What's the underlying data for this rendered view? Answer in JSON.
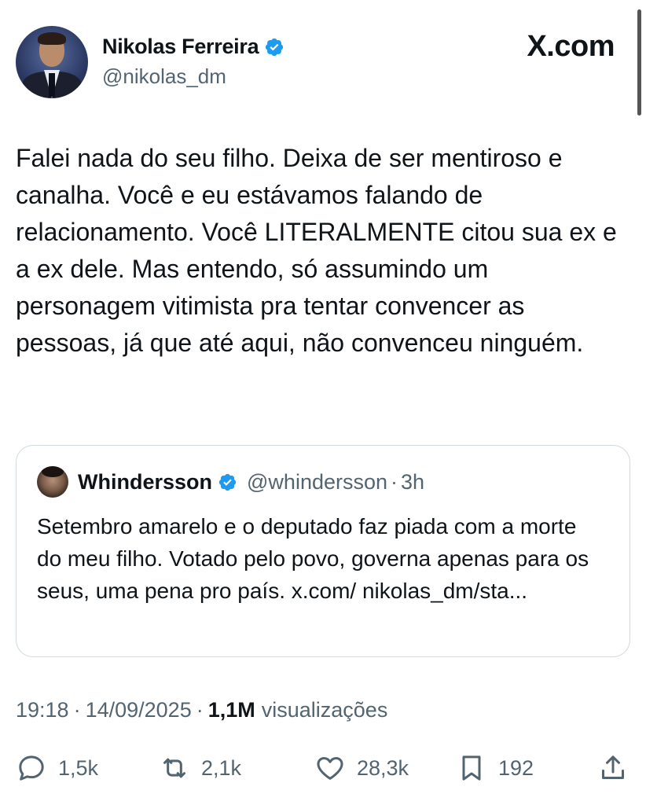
{
  "header": {
    "display_name": "Nikolas Ferreira",
    "handle": "@nikolas_dm",
    "brand": "X.com",
    "verified_color": "#1d9bf0"
  },
  "tweet": {
    "text": "Falei nada do seu filho. Deixa de ser mentiroso e canalha. Você e eu estávamos falando de relacionamento. Você LITERALMENTE citou sua ex e a ex dele. Mas entendo, só assumindo um personagem vitimista pra tentar convencer as pessoas, já que até aqui, não convenceu ninguém."
  },
  "quote": {
    "display_name": "Whindersson",
    "handle": "@whindersson",
    "separator": "·",
    "time": "3h",
    "text": "Setembro amarelo e o deputado faz piada com a morte do meu filho. Votado pelo povo, governa apenas para os seus, uma pena pro país. x.com/ nikolas_dm/sta..."
  },
  "meta": {
    "time": "19:18",
    "date": "14/09/2025",
    "views_count": "1,1M",
    "views_label": "visualizações",
    "separator": "·"
  },
  "actions": {
    "replies": "1,5k",
    "reposts": "2,1k",
    "likes": "28,3k",
    "bookmarks": "192"
  },
  "icons": {
    "reply": "reply-icon",
    "repost": "repost-icon",
    "like": "heart-icon",
    "bookmark": "bookmark-icon",
    "share": "share-icon",
    "verified": "verified-badge-icon"
  },
  "colors": {
    "text": "#0f1419",
    "secondary": "#536471",
    "border": "#cfd9de",
    "verified": "#1d9bf0"
  }
}
